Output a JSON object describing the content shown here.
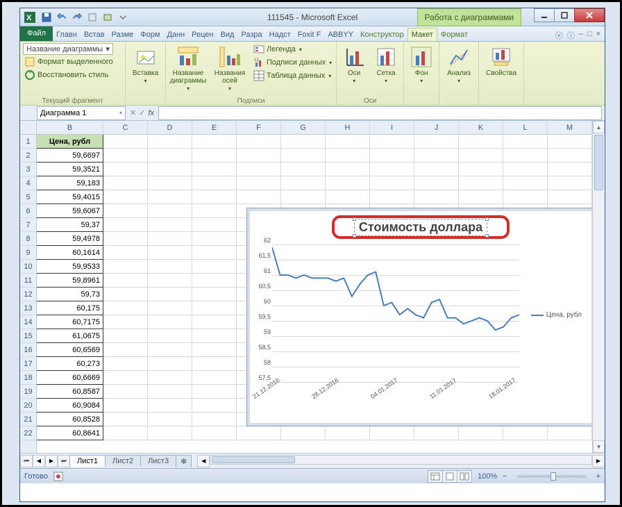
{
  "title": "111545 - Microsoft Excel",
  "chart_tools_label": "Работа с диаграммами",
  "tabs": {
    "file": "Файл",
    "items": [
      "Главн",
      "Встав",
      "Разме",
      "Форм",
      "Данн",
      "Рецен",
      "Вид",
      "Разра",
      "Надст",
      "Foxit F",
      "ABBYY"
    ],
    "ctx": [
      "Конструктор",
      "Макет",
      "Формат"
    ]
  },
  "ribbon": {
    "current_selection_dd": "Название диаграммы",
    "format_selection": "Формат выделенного",
    "reset_style": "Восстановить стиль",
    "group_current": "Текущий фрагмент",
    "insert": "Вставка",
    "chart_title": "Название диаграммы",
    "axis_titles": "Названия осей",
    "legend": "Легенда",
    "data_labels": "Подписи данных",
    "data_table": "Таблица данных",
    "group_labels": "Подписи",
    "axes": "Оси",
    "gridlines": "Сетка",
    "group_axes": "Оси",
    "background": "Фон",
    "analysis": "Анализ",
    "properties": "Свойства"
  },
  "namebox": "Диаграмма 1",
  "fx": "fx",
  "columns": [
    "B",
    "C",
    "D",
    "E",
    "F",
    "G",
    "H",
    "I",
    "J",
    "K",
    "L",
    "M"
  ],
  "data_header": "Цена, рубл",
  "data_rows": [
    "59,6697",
    "59,3521",
    "59,183",
    "59,4015",
    "59,6067",
    "59,37",
    "59,4978",
    "60,1614",
    "59,9533",
    "59,8961",
    "59,73",
    "60,175",
    "60,7175",
    "61,0675",
    "60,6569",
    "60,273",
    "60,6669",
    "60,8587",
    "60,9084",
    "60,8528",
    "60,8641"
  ],
  "sheet_tabs": [
    "Лист1",
    "Лист2",
    "Лист3"
  ],
  "status": "Готово",
  "zoom": "100%",
  "chart_data": {
    "type": "line",
    "title": "Стоимость доллара",
    "legend_label": "Цена, рубл",
    "xlabel": "",
    "ylabel": "",
    "ylim": [
      57.5,
      62
    ],
    "yticks": [
      57.5,
      58,
      58.5,
      59,
      59.5,
      60,
      60.5,
      61,
      61.5,
      62
    ],
    "x_ticks": [
      "21.12.2016",
      "28.12.2016",
      "04.01.2017",
      "11.01.2017",
      "18.01.2017"
    ],
    "series": [
      {
        "name": "Цена, рубл",
        "values": [
          61.9,
          61.0,
          61.0,
          60.9,
          61.0,
          60.9,
          60.9,
          60.9,
          60.8,
          60.9,
          60.3,
          60.7,
          61.0,
          61.1,
          60.0,
          60.1,
          59.7,
          59.9,
          59.7,
          59.6,
          60.1,
          60.2,
          59.6,
          59.6,
          59.4,
          59.5,
          59.6,
          59.5,
          59.2,
          59.3,
          59.6,
          59.7
        ]
      }
    ]
  }
}
